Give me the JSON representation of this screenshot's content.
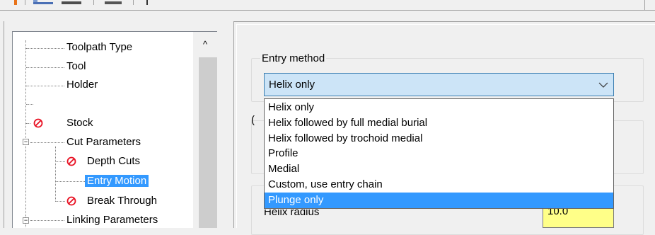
{
  "toolbar": {
    "icons": [
      "tool-icon",
      "chart-icon",
      "ruler-icon",
      "box-icon",
      "pin-icon"
    ]
  },
  "tree": {
    "items": [
      {
        "name": "tree-item-toolpath-type",
        "label": "Toolpath Type"
      },
      {
        "name": "tree-item-tool",
        "label": "Tool"
      },
      {
        "name": "tree-item-holder",
        "label": "Holder"
      },
      {
        "name": "tree-item-stock",
        "label": "Stock",
        "status_icon": "prohibited-icon"
      },
      {
        "name": "tree-item-cut-parameters",
        "label": "Cut Parameters",
        "expander": "−"
      },
      {
        "name": "tree-item-depth-cuts",
        "label": "Depth Cuts",
        "status_icon": "prohibited-icon"
      },
      {
        "name": "tree-item-entry-motion",
        "label": "Entry Motion",
        "selected": true
      },
      {
        "name": "tree-item-break-through",
        "label": "Break Through",
        "status_icon": "prohibited-icon"
      },
      {
        "name": "tree-item-linking-parameters",
        "label": "Linking Parameters",
        "expander": "−"
      }
    ],
    "scroll_up": "^"
  },
  "entry": {
    "group_title": "Entry method",
    "selected_value": "Helix only",
    "options": [
      "Helix only",
      "Helix followed by full medial burial",
      "Helix followed by trochoid medial",
      "Profile",
      "Medial",
      "Custom, use entry chain",
      "Plunge only"
    ],
    "highlighted_index": 6
  },
  "helix": {
    "label": "Helix radius",
    "value": "10.0"
  },
  "partial_label": "(",
  "colors": {
    "selection": "#3399ff",
    "combo_bg": "#cce4f7",
    "input_bg": "#ffff88",
    "status_red": "#e81123"
  }
}
